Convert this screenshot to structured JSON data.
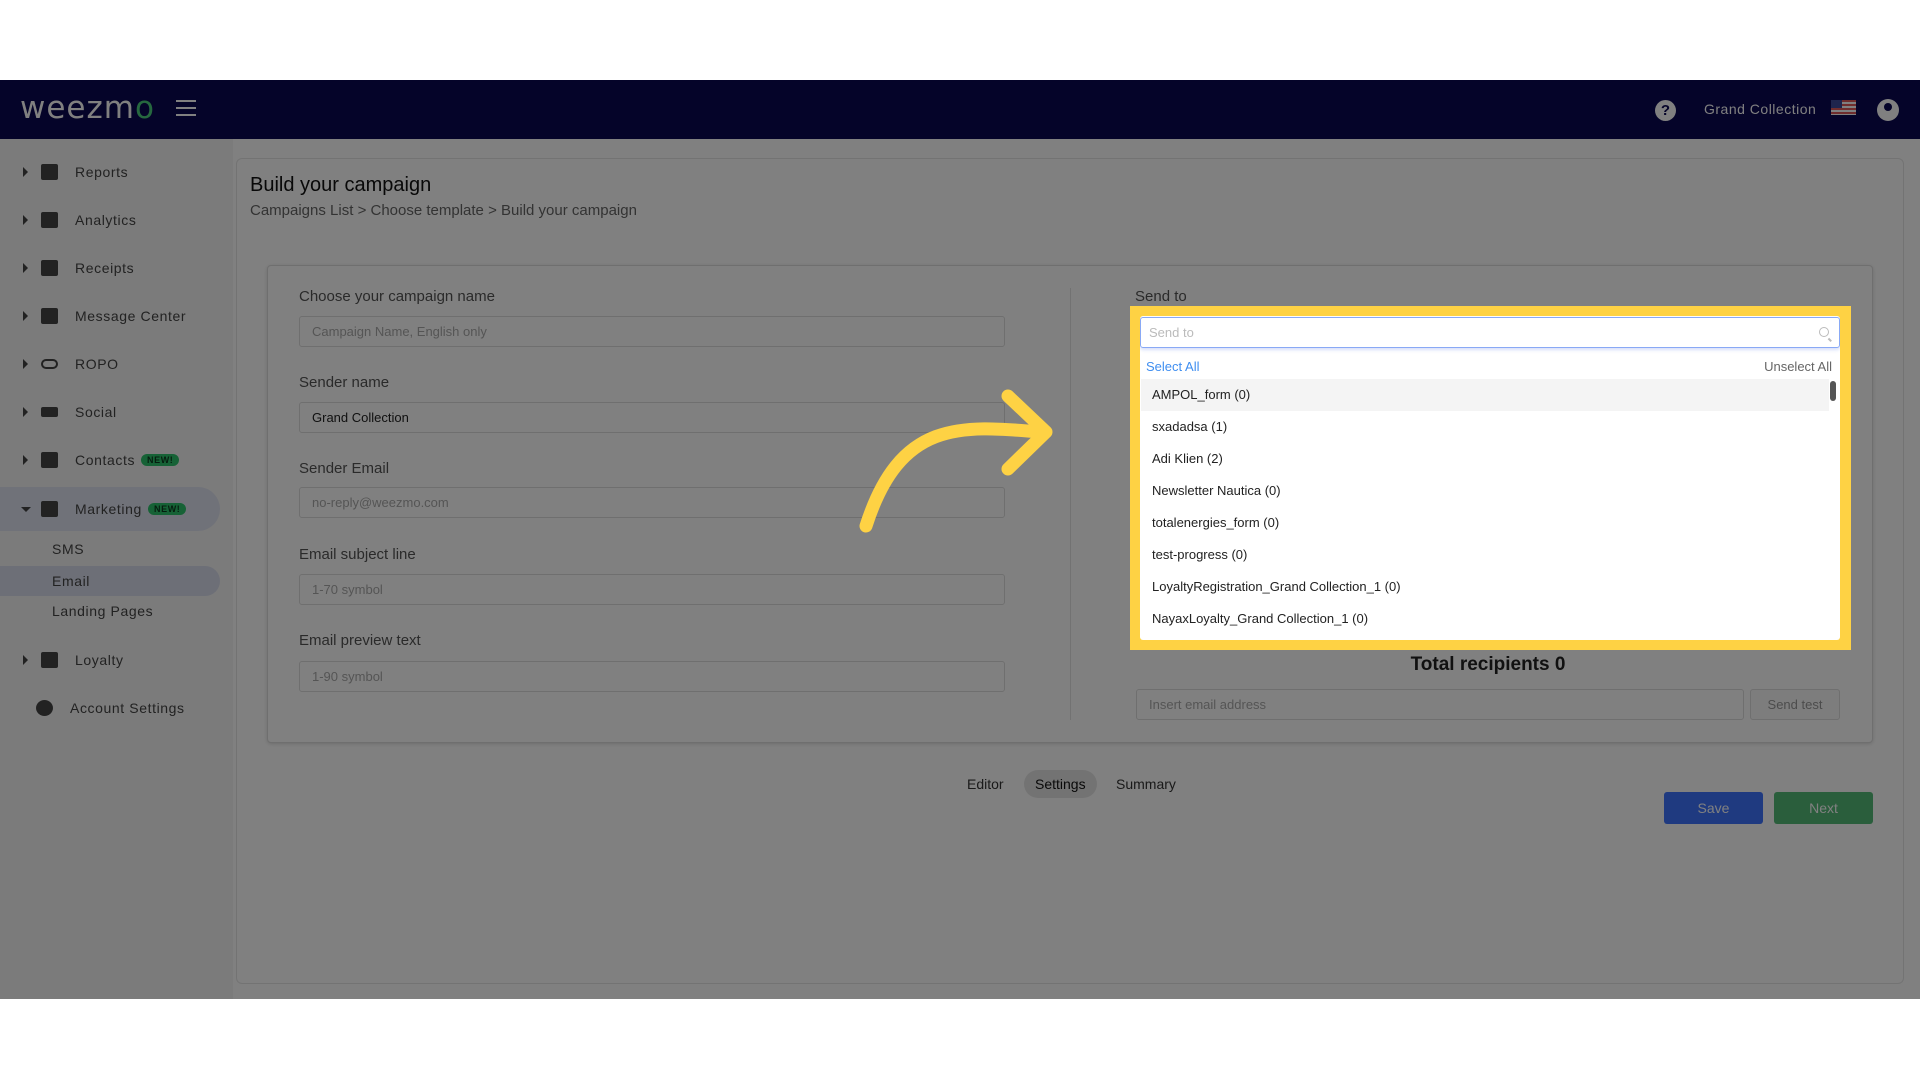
{
  "header": {
    "logo": "weezmo",
    "account_name": "Grand Collection",
    "icons": [
      "menu-icon",
      "help-icon",
      "us-flag-icon",
      "user-account-icon"
    ]
  },
  "sidebar": {
    "items": [
      {
        "label": "Reports",
        "icon": "dashboard-icon"
      },
      {
        "label": "Analytics",
        "icon": "bar-chart-icon"
      },
      {
        "label": "Receipts",
        "icon": "receipt-icon"
      },
      {
        "label": "Message Center",
        "icon": "chat-icon"
      },
      {
        "label": "ROPO",
        "icon": "infinity-icon"
      },
      {
        "label": "Social",
        "icon": "people-icon"
      },
      {
        "label": "Contacts",
        "icon": "contacts-icon",
        "badge": "NEW!"
      },
      {
        "label": "Marketing",
        "icon": "party-popper-icon",
        "badge": "NEW!",
        "expanded": true
      },
      {
        "label": "Loyalty",
        "icon": "tag-icon"
      },
      {
        "label": "Account Settings",
        "icon": "gear-icon"
      }
    ],
    "marketing_sub": [
      "SMS",
      "Email",
      "Landing Pages"
    ],
    "active_sub": "Email"
  },
  "page": {
    "title": "Build your campaign",
    "breadcrumb": [
      "Campaigns List",
      ">",
      "Choose template",
      ">",
      "Build your campaign"
    ]
  },
  "form": {
    "campaign_name": {
      "label": "Choose your campaign name",
      "placeholder": "Campaign Name, English only"
    },
    "sender_name": {
      "label": "Sender name",
      "value": "Grand Collection"
    },
    "sender_email": {
      "label": "Sender Email",
      "placeholder": "no-reply@weezmo.com"
    },
    "subject": {
      "label": "Email subject line",
      "placeholder": "1-70 symbol"
    },
    "preview": {
      "label": "Email preview text",
      "placeholder": "1-90 symbol"
    }
  },
  "send_to": {
    "label": "Send to",
    "placeholder": "Send to",
    "select_all": "Select All",
    "unselect_all": "Unselect All",
    "options": [
      "AMPOL_form (0)",
      "sxadadsa (1)",
      "Adi Klien (2)",
      "Newsletter Nautica (0)",
      "totalenergies_form (0)",
      "test-progress (0)",
      "LoyaltyRegistration_Grand Collection_1 (0)",
      "NayaxLoyalty_Grand Collection_1 (0)"
    ],
    "total_recipients": "Total recipients 0",
    "test_email_placeholder": "Insert email address",
    "send_test": "Send test"
  },
  "tabs": {
    "items": [
      "Editor",
      "Settings",
      "Summary"
    ],
    "active": "Settings"
  },
  "actions": {
    "save": "Save",
    "next": "Next"
  },
  "colors": {
    "highlight": "#fed244",
    "save": "#3d74ff",
    "next": "#54bc78",
    "header": "#0a0852"
  }
}
